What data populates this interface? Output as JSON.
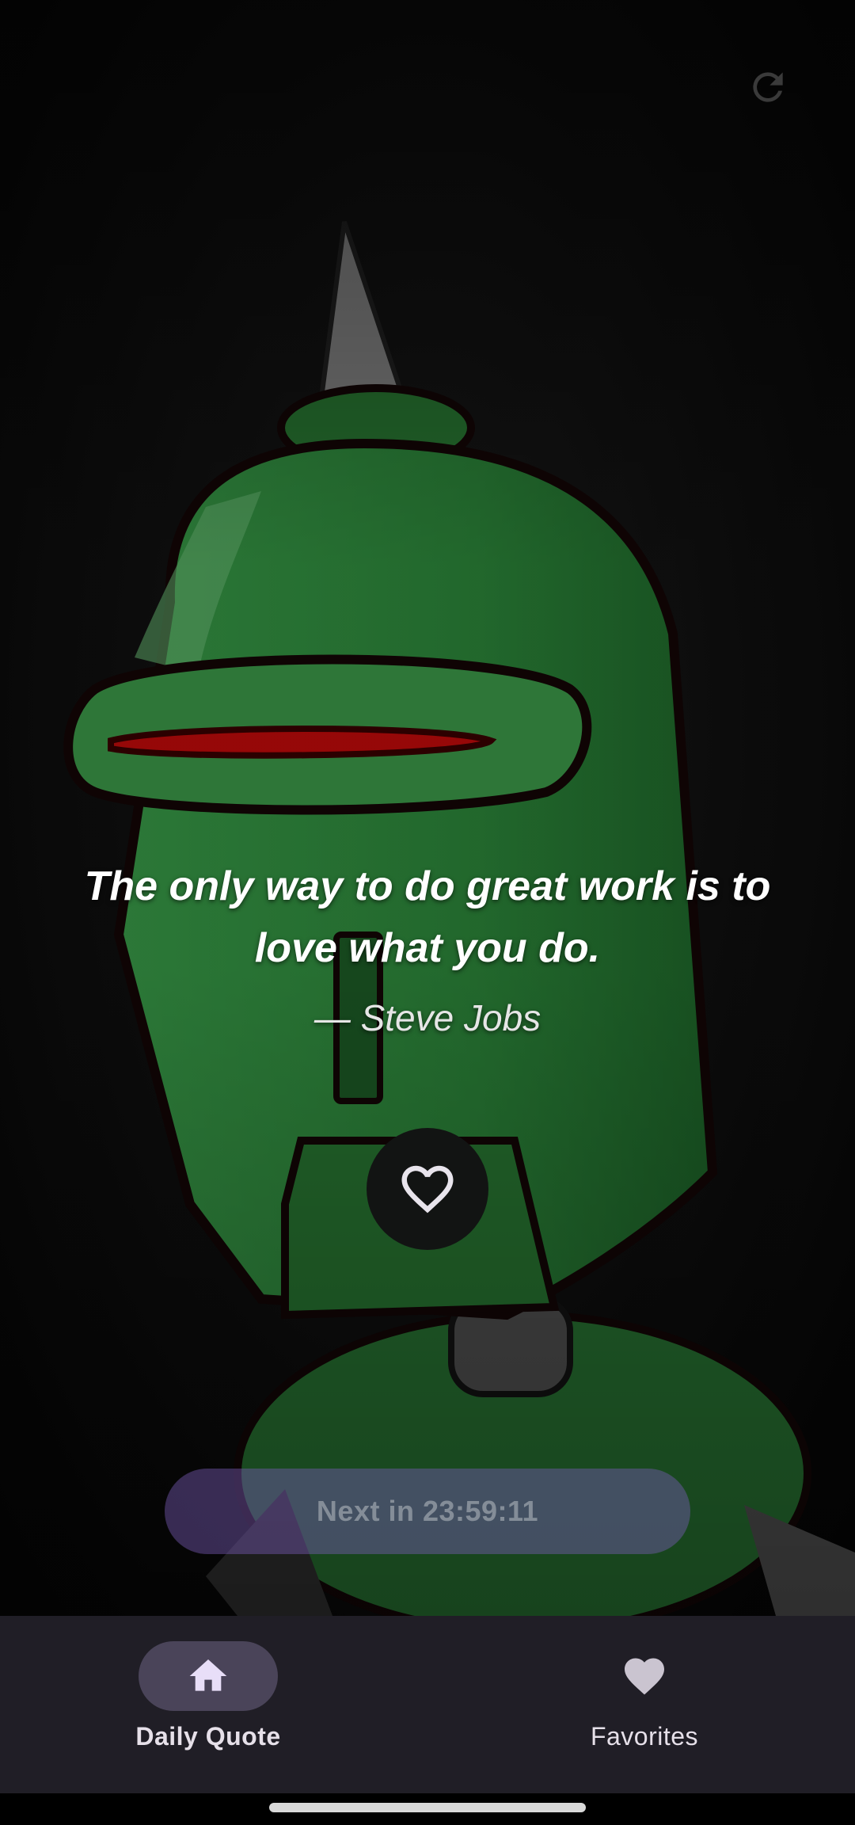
{
  "app": {
    "toolbar": {
      "refresh_icon": "refresh-icon"
    },
    "quote": {
      "text": "The only way to do great work is to love what you do.",
      "author": "— Steve Jobs"
    },
    "favorite_button": {
      "icon": "heart-outline-icon"
    },
    "next_button": {
      "label": "Next in 23:59:11"
    },
    "bottom_nav": {
      "items": [
        {
          "label": "Daily Quote",
          "icon": "home-icon",
          "active": true
        },
        {
          "label": "Favorites",
          "icon": "heart-icon",
          "active": false
        }
      ]
    },
    "colors": {
      "nav_background": "#201e26",
      "active_pill": "#4a4459",
      "robot_green": "#2e8a3c",
      "visor_red": "#c80a0a"
    }
  }
}
